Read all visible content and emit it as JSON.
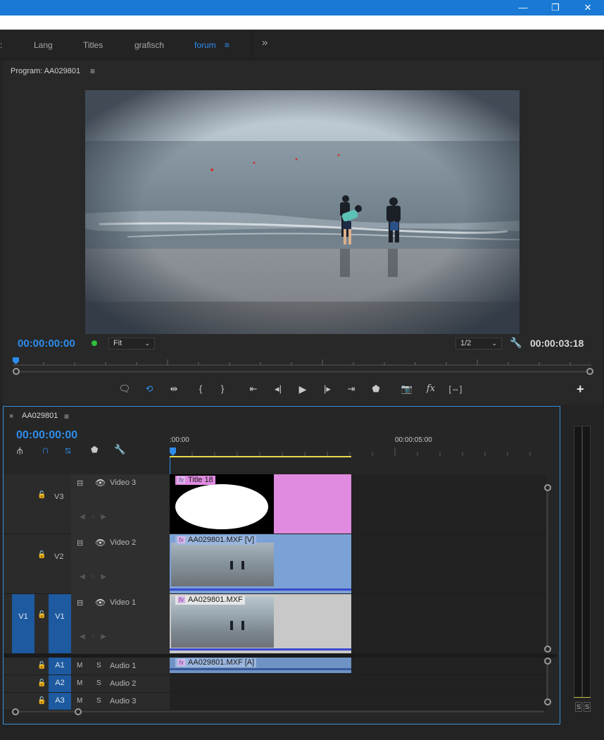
{
  "window": {
    "minimize": "—",
    "restore": "❐",
    "close": "✕"
  },
  "workspaces": {
    "cut": ":",
    "tabs": [
      "Lang",
      "Titles",
      "grafisch",
      "forum"
    ],
    "active": "forum",
    "menu_icon": "≡",
    "overflow": "»"
  },
  "program": {
    "title": "Program: AA029801",
    "menu_icon": "≡",
    "timecode_current": "00:00:00:00",
    "fit": "Fit",
    "resolution": "1/2",
    "timecode_duration": "00:00:03:18",
    "add_button": "+",
    "colors": {
      "accent": "#2d8ceb",
      "dot": "#2fbf3b"
    }
  },
  "timeline": {
    "close": "×",
    "sequence_name": "AA029801",
    "menu_icon": "≡",
    "timecode": "00:00:00:00",
    "ruler": {
      "start": ":00:00",
      "mid": "00:00:05:00"
    },
    "tracks": [
      {
        "id": "V3",
        "name": "Video 3",
        "clip": "Title 18"
      },
      {
        "id": "V2",
        "name": "Video 2",
        "clip": "AA029801.MXF [V]"
      },
      {
        "id": "V1",
        "name": "Video 1",
        "clip": "AA029801.MXF",
        "src": "V1"
      }
    ],
    "audio": [
      {
        "id": "A1",
        "name": "Audio 1",
        "m": "M",
        "s": "S",
        "clip": "AA029801.MXF [A]"
      },
      {
        "id": "A2",
        "name": "Audio 2",
        "m": "M",
        "s": "S"
      },
      {
        "id": "A3",
        "name": "Audio 3",
        "m": "M",
        "s": "S"
      }
    ],
    "fx_badge": "fx"
  },
  "meter": {
    "s1": "S",
    "s2": "S"
  }
}
